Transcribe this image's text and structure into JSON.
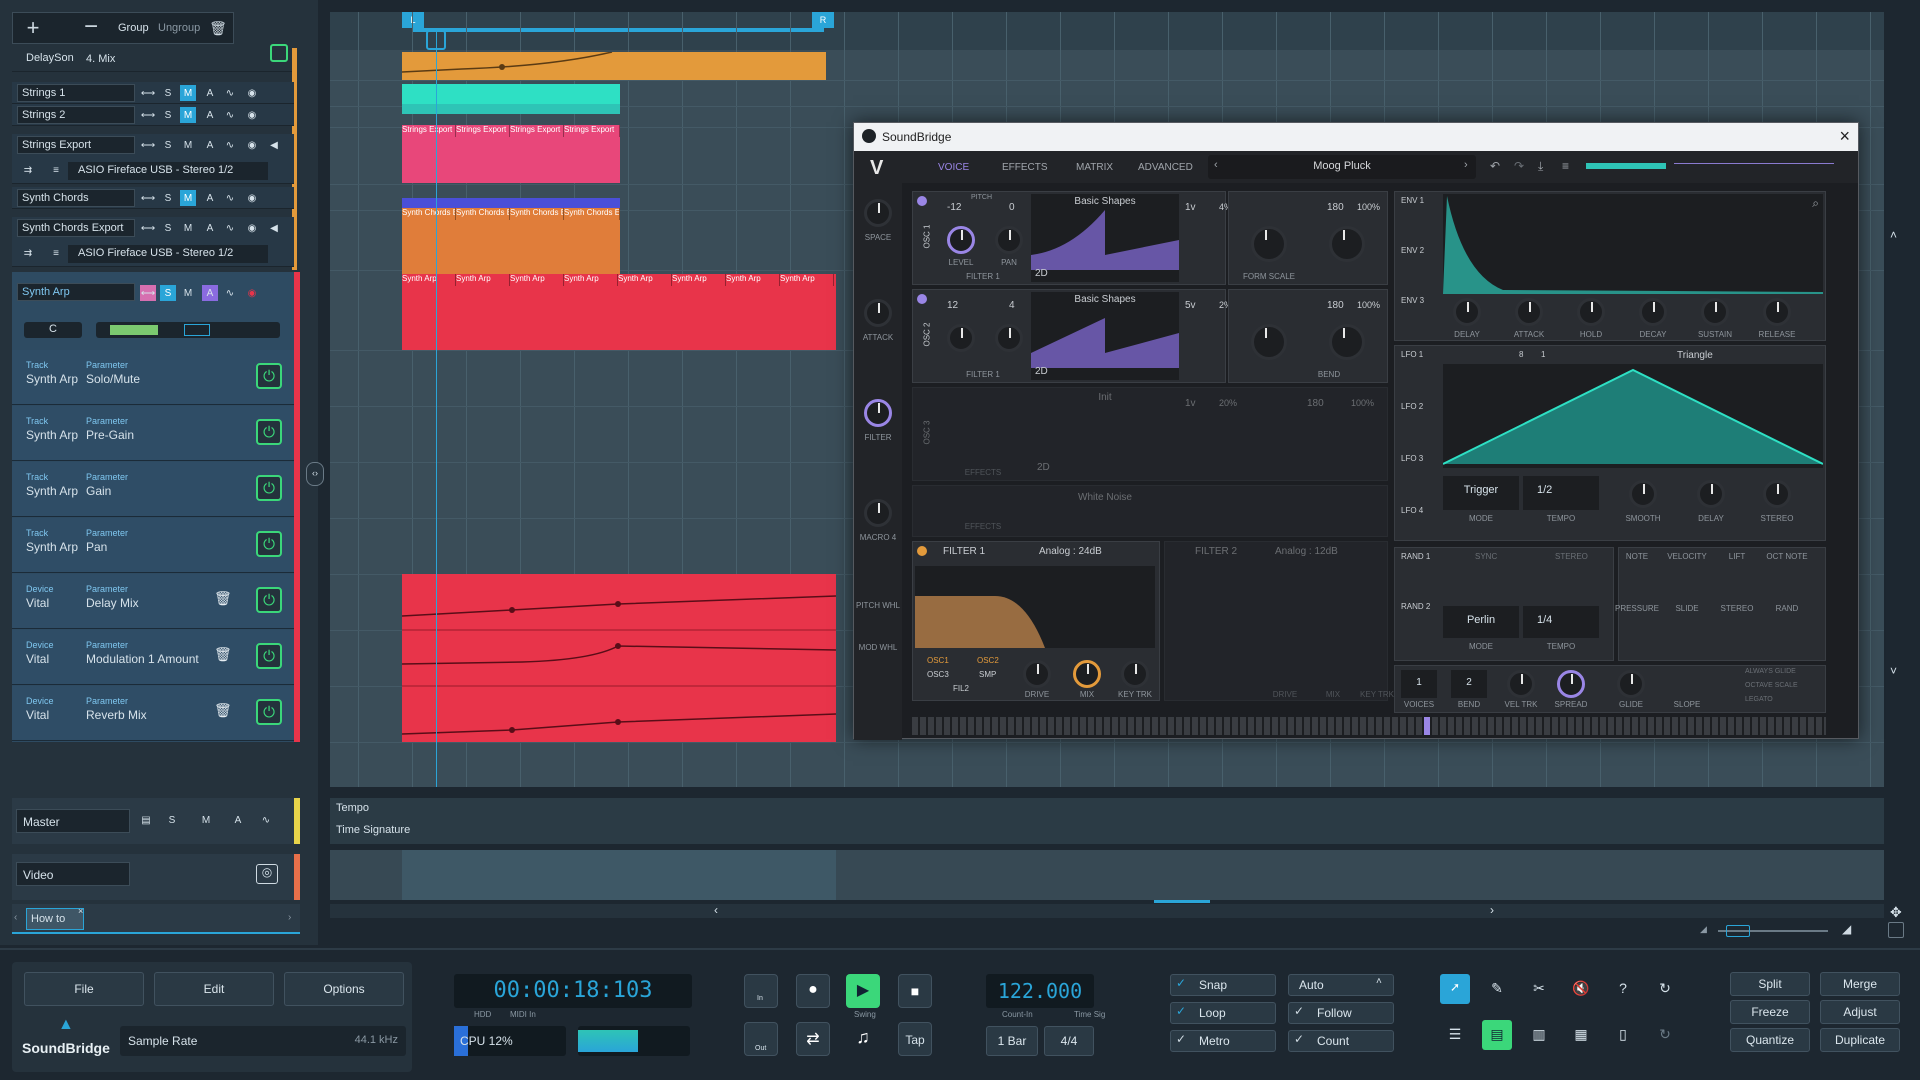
{
  "toolbar": {
    "group": "Group",
    "ungroup": "Ungroup"
  },
  "tracks": [
    {
      "name": "DelaySon",
      "extra": "4. Mix"
    },
    {
      "name": "Strings 1"
    },
    {
      "name": "Strings 2"
    },
    {
      "name": "Strings Export"
    },
    {
      "name": "Synth Chords"
    },
    {
      "name": "Synth Chords Export"
    },
    {
      "name": "Synth Arp"
    }
  ],
  "io": {
    "output": "ASIO Fireface USB - Stereo 1/2"
  },
  "arp": {
    "key": "C"
  },
  "automation": [
    {
      "k1": "Track",
      "v1": "Synth Arp",
      "k2": "Parameter",
      "v2": "Solo/Mute"
    },
    {
      "k1": "Track",
      "v1": "Synth Arp",
      "k2": "Parameter",
      "v2": "Pre-Gain"
    },
    {
      "k1": "Track",
      "v1": "Synth Arp",
      "k2": "Parameter",
      "v2": "Gain"
    },
    {
      "k1": "Track",
      "v1": "Synth Arp",
      "k2": "Parameter",
      "v2": "Pan"
    },
    {
      "k1": "Device",
      "v1": "Vital",
      "k2": "Parameter",
      "v2": "Delay Mix"
    },
    {
      "k1": "Device",
      "v1": "Vital",
      "k2": "Parameter",
      "v2": "Modulation 1 Amount"
    },
    {
      "k1": "Device",
      "v1": "Vital",
      "k2": "Parameter",
      "v2": "Reverb Mix"
    }
  ],
  "master": {
    "name": "Master"
  },
  "video": {
    "name": "Video"
  },
  "howto": "How to",
  "ruler": {
    "loop_left": "L",
    "loop_right": "R"
  },
  "clips": {
    "strings_export": "Strings Export",
    "synth_chords_export": "Synth Chords Exp",
    "synth_arp": "Synth Arp"
  },
  "globaltracks": {
    "tempo": "Tempo",
    "timesig": "Time Signature"
  },
  "plugin": {
    "window_title": "SoundBridge",
    "close": "×",
    "tabs": [
      "VOICE",
      "EFFECTS",
      "MATRIX",
      "ADVANCED"
    ],
    "preset": "Moog Pluck",
    "osc1": {
      "label": "OSC 1",
      "pitch": "-12",
      "pitch2": "0",
      "pitch_label": "PITCH",
      "wave": "Basic Shapes",
      "unison": "1v",
      "unison_pct": "4%",
      "phase": "180",
      "phase_pct": "100%",
      "level": "LEVEL",
      "pan": "PAN",
      "filter": "FILTER 1",
      "form": "FORM SCALE",
      "dim": "2D"
    },
    "osc2": {
      "label": "OSC 2",
      "pitch": "12",
      "pitch2": "4",
      "wave": "Basic Shapes",
      "unison": "5v",
      "unison_pct": "2%",
      "phase": "180",
      "phase_pct": "100%",
      "filter": "FILTER 1",
      "bend": "BEND",
      "dim": "2D"
    },
    "osc3": {
      "label": "OSC 3",
      "wave": "Init",
      "unison": "1v",
      "unison_pct": "20%",
      "phase": "180",
      "phase_pct": "100%",
      "effects": "EFFECTS",
      "dim": "2D"
    },
    "smp": {
      "wave": "White Noise",
      "effects": "EFFECTS"
    },
    "side": [
      "SPACE",
      "ATTACK",
      "FILTER",
      "MACRO 4",
      "PITCH WHL",
      "MOD WHL"
    ],
    "filter1": {
      "label": "FILTER 1",
      "type": "Analog : 24dB",
      "routes": [
        "OSC1",
        "OSC2",
        "OSC3",
        "SMP",
        "FIL2"
      ],
      "knobs": [
        "DRIVE",
        "MIX",
        "KEY TRK"
      ]
    },
    "filter2": {
      "label": "FILTER 2",
      "type": "Analog : 12dB",
      "knobs": [
        "DRIVE",
        "MIX",
        "KEY TRK"
      ]
    },
    "env": {
      "labels": [
        "ENV 1",
        "ENV 2",
        "ENV 3"
      ],
      "knobs": [
        "DELAY",
        "ATTACK",
        "HOLD",
        "DECAY",
        "SUSTAIN",
        "RELEASE"
      ]
    },
    "lfo": {
      "labels": [
        "LFO 1",
        "LFO 2",
        "LFO 3",
        "LFO 4"
      ],
      "shape": "Triangle",
      "grid1": "8",
      "grid2": "1",
      "mode": "Trigger",
      "mode_label": "MODE",
      "tempo": "1/2",
      "tempo_label": "TEMPO",
      "knobs": [
        "SMOOTH",
        "DELAY",
        "STEREO"
      ]
    },
    "rand": {
      "labels": [
        "RAND 1",
        "RAND 2"
      ],
      "sync": "SYNC",
      "stereo": "STEREO",
      "mode": "Perlin",
      "mode_label": "MODE",
      "tempo": "1/4",
      "tempo_label": "TEMPO"
    },
    "mod": {
      "labels": [
        "NOTE",
        "VELOCITY",
        "LIFT",
        "OCT NOTE",
        "PRESSURE",
        "SLIDE",
        "STEREO",
        "RAND"
      ]
    },
    "voice": {
      "voices": "1",
      "voices_label": "VOICES",
      "bend": "2",
      "bend_label": "BEND",
      "veltrk": "VEL TRK",
      "spread": "SPREAD",
      "glide": "GLIDE",
      "slope": "SLOPE",
      "opts": [
        "ALWAYS GLIDE",
        "OCTAVE SCALE",
        "LEGATO"
      ]
    }
  },
  "transport": {
    "file": "File",
    "edit": "Edit",
    "options": "Options",
    "brand": "SoundBridge",
    "sample_rate_label": "Sample Rate",
    "sample_rate": "44.1 kHz",
    "time": "00:00:18:103",
    "hdd": "HDD",
    "midi_in": "MIDI In",
    "cpu": "CPU 12%",
    "in": "In",
    "out": "Out",
    "swing": "Swing",
    "tap": "Tap",
    "tempo": "122.000",
    "countin_label": "Count-In",
    "timesig_label": "Time Sig",
    "countin": "1 Bar",
    "timesig": "4/4",
    "snap": "Snap",
    "auto": "Auto",
    "loop": "Loop",
    "follow": "Follow",
    "metro": "Metro",
    "count": "Count",
    "split": "Split",
    "merge": "Merge",
    "freeze": "Freeze",
    "adjust": "Adjust",
    "quantize": "Quantize",
    "duplicate": "Duplicate"
  },
  "colors": {
    "accent": "#2aa5d8",
    "orange": "#e39a3b",
    "teal": "#2ec4b6",
    "pink": "#e8475f",
    "red": "#e8344a",
    "green": "#3bd77a",
    "vital_purple": "#9a86e6"
  }
}
